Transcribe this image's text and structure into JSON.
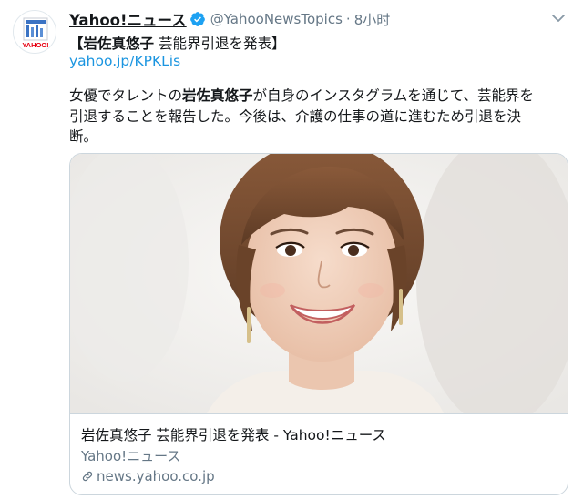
{
  "tweet": {
    "author": {
      "display_name": "Yahoo!ニュース",
      "handle": "@YahooNewsTopics",
      "separator": "·",
      "time": "8小时",
      "avatar_logo_text": "YAHOO!"
    },
    "title_prefix": "【",
    "title_name": "岩佐真悠子",
    "title_rest": " 芸能界引退を発表】",
    "link": "yahoo.jp/KPKLis",
    "body_before": "女優でタレントの",
    "body_name": "岩佐真悠子",
    "body_after_line1": "が自身のインスタグラムを通じて、芸能界を",
    "body_line2": "引退することを報告した。今後は、介護の仕事の道に進むため引退を決",
    "body_line3": "断。"
  },
  "card": {
    "title": "岩佐真悠子 芸能界引退を発表 - Yahoo!ニュース",
    "source": "Yahoo!ニュース",
    "url": "news.yahoo.co.jp"
  },
  "icons": {
    "verified": "verified-badge-icon",
    "caret": "chevron-down-icon",
    "link": "link-icon"
  },
  "colors": {
    "link_blue": "#1b95e0",
    "muted_gray": "#657786",
    "verified_blue": "#1da1f2",
    "border": "#ccd6dd"
  }
}
